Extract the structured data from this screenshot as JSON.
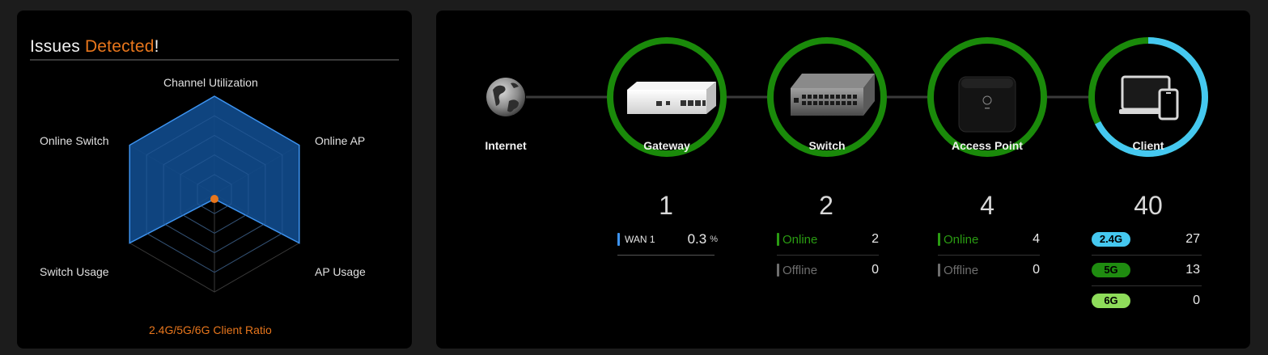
{
  "issues": {
    "title_prefix": "Issues ",
    "title_accent": "Detected",
    "title_suffix": "!",
    "radar": {
      "axes": [
        {
          "label": "Channel Utilization",
          "value": 1.0
        },
        {
          "label": "Online AP",
          "value": 1.0
        },
        {
          "label": "AP Usage",
          "value": 1.0
        },
        {
          "label": "2.4G/5G/6G Client Ratio",
          "value": 0.05
        },
        {
          "label": "Switch Usage",
          "value": 1.0
        },
        {
          "label": "Online Switch",
          "value": 1.0
        }
      ],
      "fill_color": "#104a8a",
      "stroke_color": "#3d93f0",
      "warn_color": "#e8761c"
    }
  },
  "topology": {
    "nodes": [
      {
        "key": "internet",
        "label": "Internet",
        "icon": "globe-icon"
      },
      {
        "key": "gateway",
        "label": "Gateway",
        "icon": "gateway-device-icon",
        "count": "1",
        "ring_color": "#1a8a0a"
      },
      {
        "key": "switch",
        "label": "Switch",
        "icon": "switch-device-icon",
        "count": "2",
        "ring_color": "#1a8a0a"
      },
      {
        "key": "ap",
        "label": "Access Point",
        "icon": "access-point-device-icon",
        "count": "4",
        "ring_color": "#1a8a0a"
      },
      {
        "key": "client",
        "label": "Client",
        "icon": "client-devices-icon",
        "count": "40",
        "ring_color": "#1a8a0a",
        "ring_accent_color": "#45c8f0"
      }
    ],
    "gateway_stats": [
      {
        "label": "WAN 1",
        "value": "0.3",
        "unit": "%",
        "color": "#3d93f0"
      }
    ],
    "switch_stats": [
      {
        "label": "Online",
        "value": "2",
        "color": "#2a9c12"
      },
      {
        "label": "Offline",
        "value": "0",
        "color": "#6e6e6e"
      }
    ],
    "ap_stats": [
      {
        "label": "Online",
        "value": "4",
        "color": "#2a9c12"
      },
      {
        "label": "Offline",
        "value": "0",
        "color": "#6e6e6e"
      }
    ],
    "client_stats": [
      {
        "label": "2.4G",
        "value": "27",
        "color": "#45c8f0"
      },
      {
        "label": "5G",
        "value": "13",
        "color": "#1f8c10"
      },
      {
        "label": "6G",
        "value": "0",
        "color": "#8edc5a"
      }
    ]
  }
}
